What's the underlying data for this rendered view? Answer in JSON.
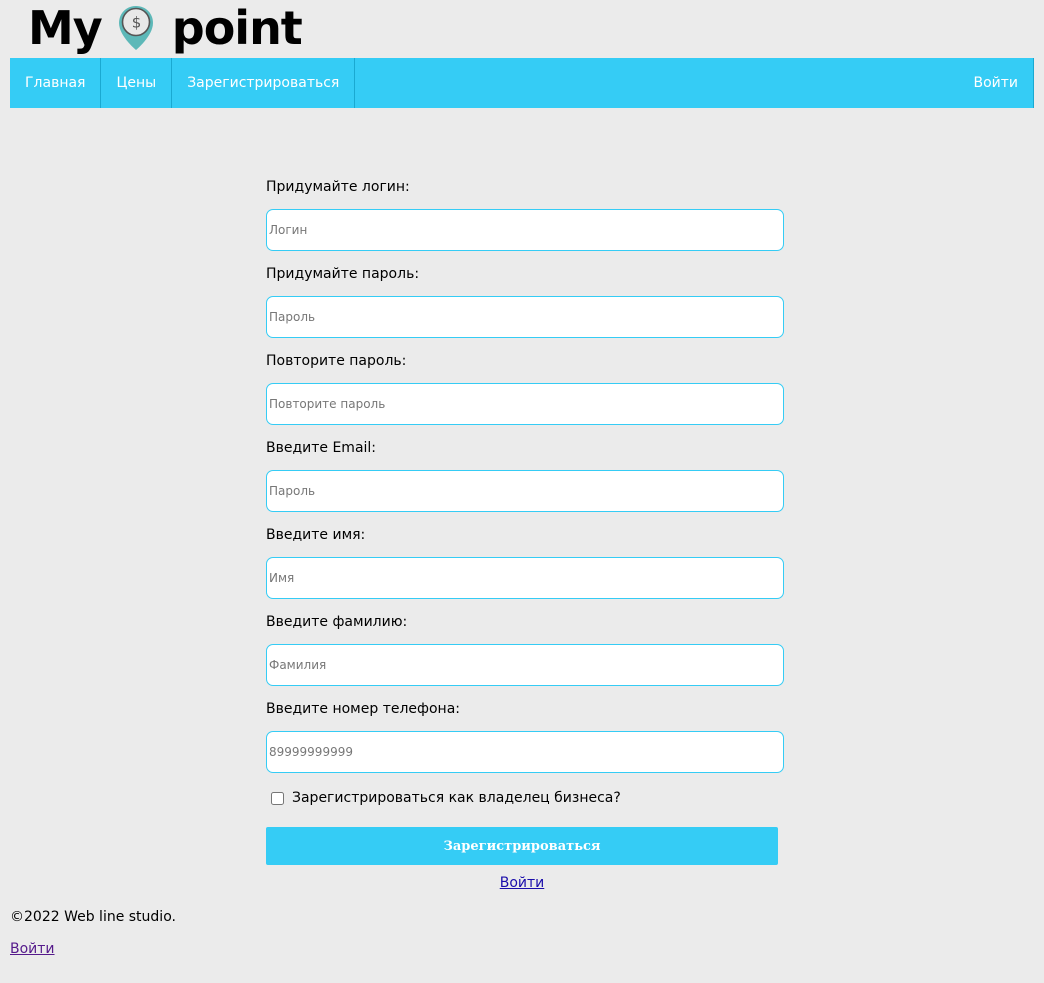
{
  "logo": {
    "word_left": "My",
    "word_right": "point",
    "pin_symbol": "$",
    "pin_color": "#5db8b8"
  },
  "nav": {
    "items": [
      {
        "label": "Главная"
      },
      {
        "label": "Цены"
      },
      {
        "label": "Зарегистрироваться"
      }
    ],
    "login_label": "Войти",
    "background": "#35ccf5"
  },
  "form": {
    "fields": [
      {
        "label": "Придумайте логин:",
        "placeholder": "Логин",
        "value": ""
      },
      {
        "label": "Придумайте пароль:",
        "placeholder": "Пароль",
        "value": ""
      },
      {
        "label": "Повторите пароль:",
        "placeholder": "Повторите пароль",
        "value": ""
      },
      {
        "label": "Введите Email:",
        "placeholder": "Пароль",
        "value": ""
      },
      {
        "label": "Введите имя:",
        "placeholder": "Имя",
        "value": ""
      },
      {
        "label": "Введите фамилию:",
        "placeholder": "Фамилия",
        "value": ""
      },
      {
        "label": "Введите номер телефона:",
        "placeholder": "89999999999",
        "value": ""
      }
    ],
    "business_checkbox_label": "Зарегистрироваться как владелец бизнеса?",
    "business_checkbox_checked": false,
    "submit_label": "Зарегистрироваться",
    "login_link": "Войти"
  },
  "footer": {
    "copyright": "©2022 Web line studio.",
    "login_link": "Войти"
  }
}
